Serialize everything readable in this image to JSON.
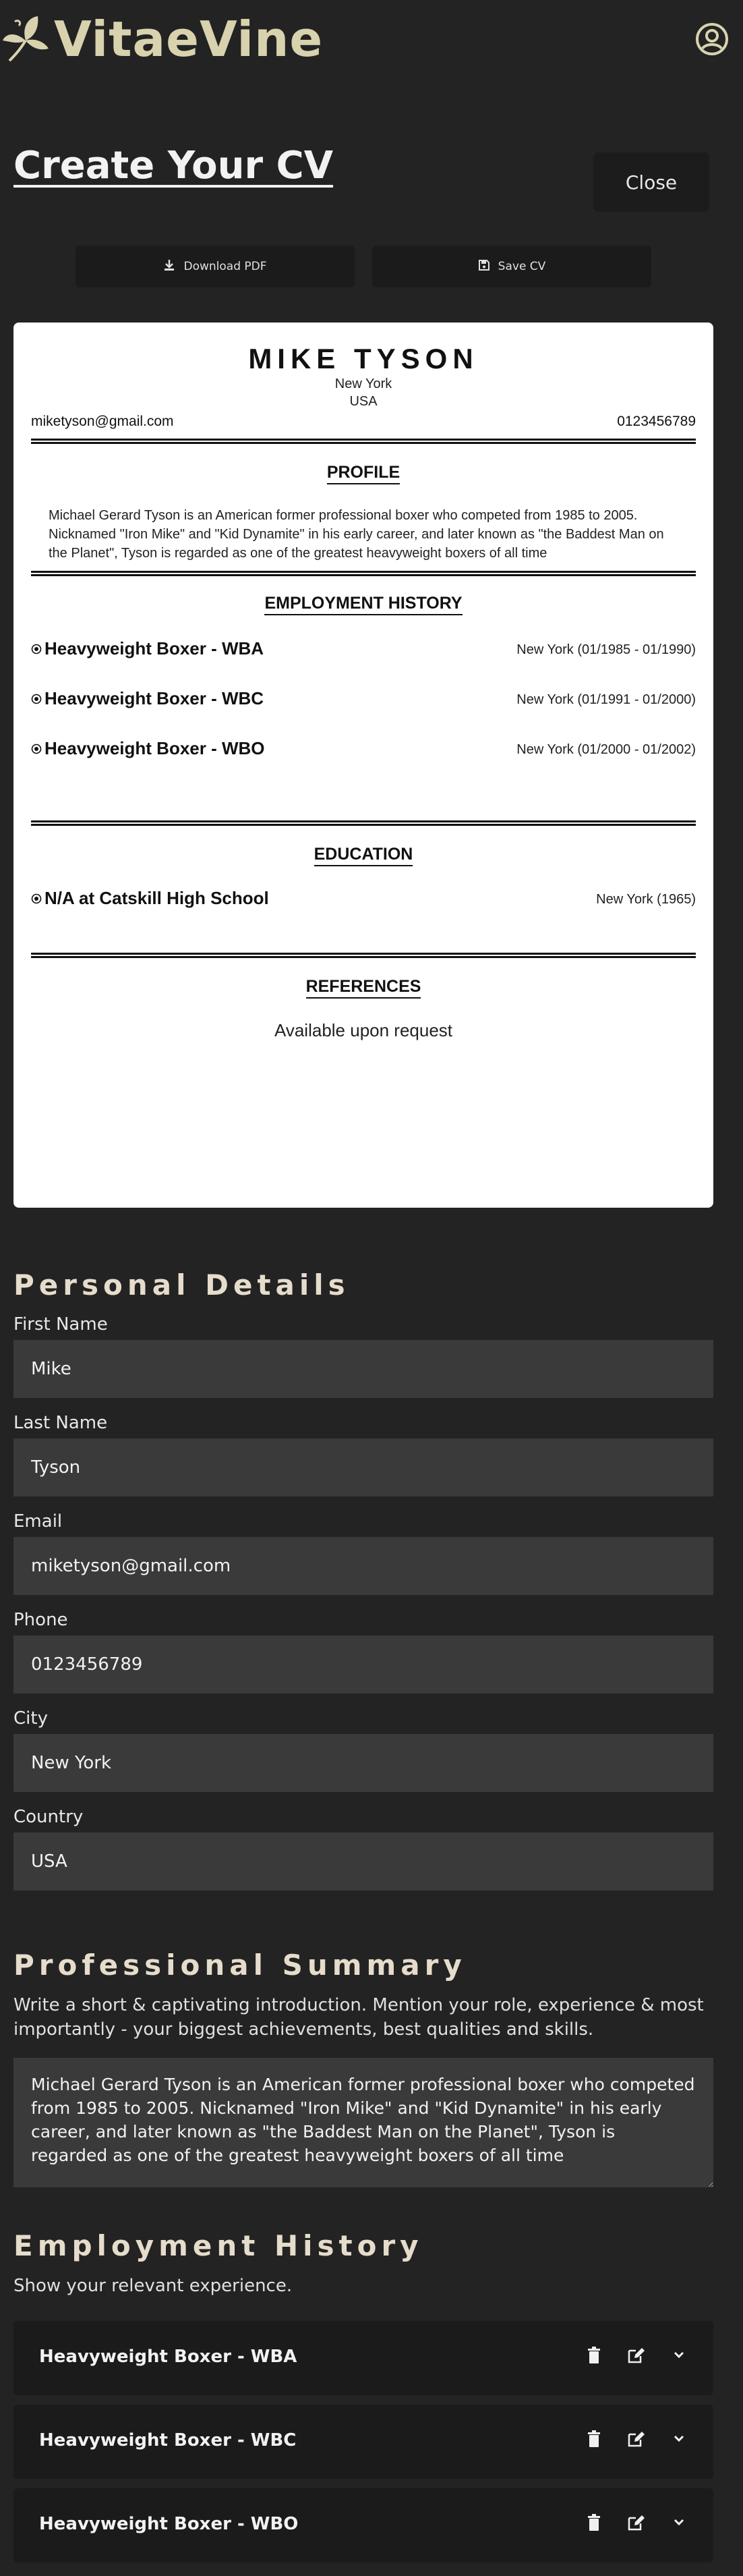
{
  "app": {
    "title": "VitaeVine"
  },
  "header": {
    "page_title": "Create Your CV",
    "close_label": "Close"
  },
  "actions": {
    "download_label": "Download PDF",
    "save_label": "Save CV"
  },
  "cv_preview": {
    "name": "MIKE TYSON",
    "city": "New York",
    "country": "USA",
    "email": "miketyson@gmail.com",
    "phone": "0123456789",
    "profile_title": "PROFILE",
    "summary": "Michael Gerard Tyson is an American former professional boxer who competed from 1985 to 2005. Nicknamed \"Iron Mike\" and \"Kid Dynamite\" in his early career, and later known as \"the Baddest Man on the Planet\", Tyson is regarded as one of the greatest heavyweight boxers of all time",
    "employment_title": "EMPLOYMENT HISTORY",
    "employment": [
      {
        "title": "Heavyweight Boxer - WBA",
        "meta": "New York (01/1985 - 01/1990)"
      },
      {
        "title": "Heavyweight Boxer - WBC",
        "meta": "New York (01/1991 - 01/2000)"
      },
      {
        "title": "Heavyweight Boxer - WBO",
        "meta": "New York (01/2000 - 01/2002)"
      }
    ],
    "education_title": "EDUCATION",
    "education": [
      {
        "title": "N/A at Catskill High School",
        "meta": "New York (1965)"
      }
    ],
    "references_title": "REFERENCES",
    "references_text": "Available upon request"
  },
  "personal_details": {
    "heading": "Personal Details",
    "first_name": {
      "label": "First Name",
      "value": "Mike"
    },
    "last_name": {
      "label": "Last Name",
      "value": "Tyson"
    },
    "email": {
      "label": "Email",
      "value": "miketyson@gmail.com"
    },
    "phone": {
      "label": "Phone",
      "value": "0123456789"
    },
    "city": {
      "label": "City",
      "value": "New York"
    },
    "country": {
      "label": "Country",
      "value": "USA"
    }
  },
  "professional_summary": {
    "heading": "Professional Summary",
    "description": "Write a short & captivating introduction. Mention your role, experience & most importantly - your biggest achievements, best qualities and skills.",
    "value": "Michael Gerard Tyson is an American former professional boxer who competed from 1985 to 2005. Nicknamed \"Iron Mike\" and \"Kid Dynamite\" in his early career, and later known as \"the Baddest Man on the Planet\", Tyson is regarded as one of the greatest heavyweight boxers of all time"
  },
  "employment_history": {
    "heading": "Employment History",
    "description": "Show your relevant experience.",
    "items": [
      {
        "title": "Heavyweight Boxer - WBA"
      },
      {
        "title": "Heavyweight Boxer - WBC"
      },
      {
        "title": "Heavyweight Boxer - WBO"
      }
    ]
  },
  "icons": {
    "logo": "vine-leaf-icon",
    "profile": "user-circle-icon",
    "download": "download-icon",
    "save": "floppy-disk-icon",
    "delete": "trash-icon",
    "edit": "edit-icon",
    "expand": "chevron-down-icon",
    "bullet": "target-circle-icon"
  },
  "colors": {
    "background": "#232323",
    "brand": "#d8d2ae",
    "heading_accent": "#e6dccb",
    "input_bg": "#3a3a3a"
  }
}
